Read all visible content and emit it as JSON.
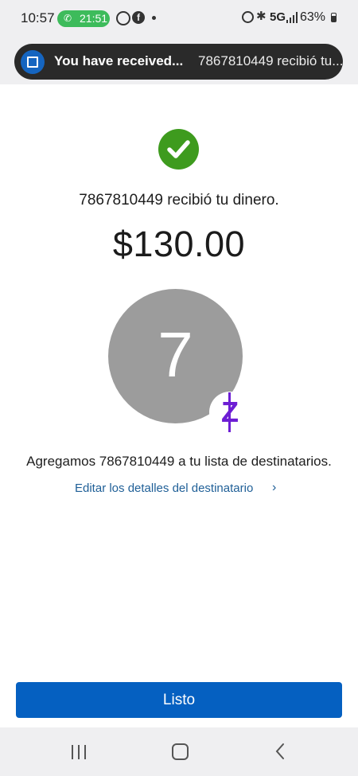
{
  "status_bar": {
    "time": "10:57",
    "call_timer": "21:51",
    "network": "5G",
    "battery": "63%",
    "icons": [
      "phone-icon",
      "whatsapp-icon",
      "facebook-icon",
      "dot-icon",
      "alarm-icon",
      "bluetooth-icon",
      "signal-icon",
      "battery-icon"
    ]
  },
  "notification": {
    "title": "You have received...",
    "body": "7867810449 recibió tu...",
    "app_icon": "chase-logo-icon"
  },
  "confirmation": {
    "icon": "checkmark-icon",
    "message": "7867810449 recibió tu dinero.",
    "amount": "$130.00"
  },
  "recipient": {
    "initial": "7",
    "badge": "Z"
  },
  "info": {
    "added_message": "Agregamos 7867810449 a tu lista de destinatarios.",
    "edit_link": "Editar los detalles del destinatario",
    "edit_chevron": "›"
  },
  "actions": {
    "done_label": "Listo"
  },
  "colors": {
    "primary_button": "#0560c1",
    "success": "#3e9b1e",
    "link": "#1f5f97",
    "zelle_purple": "#6d1ed4",
    "avatar_gray": "#9c9c9c"
  }
}
